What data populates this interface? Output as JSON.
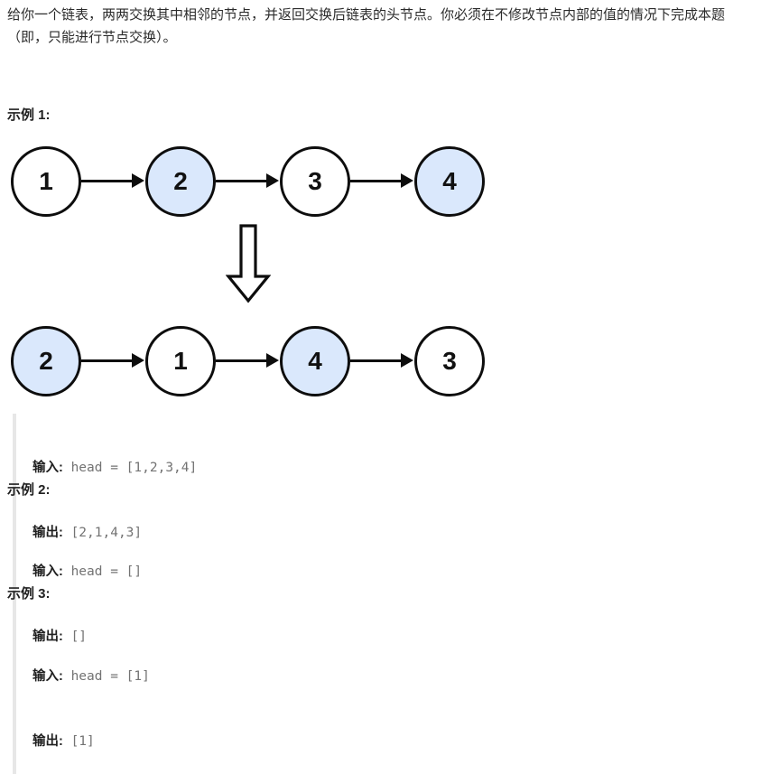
{
  "problem": {
    "description": "给你一个链表，两两交换其中相邻的节点，并返回交换后链表的头节点。你必须在不修改节点内部的值的情况下完成本题（即，只能进行节点交换）。"
  },
  "colors": {
    "highlight_node_fill": "#dae8fc",
    "node_stroke": "#0d0d0d",
    "node_fill": "#ffffff",
    "code_text": "#737373",
    "blockquote_border": "#e7e7e7",
    "body_text": "#2b2b2b"
  },
  "examples": [
    {
      "heading": "示例 1:",
      "input_label": "输入:",
      "input_value": " head = [1,2,3,4]",
      "output_label": "输出:",
      "output_value": " [2,1,4,3]"
    },
    {
      "heading": "示例 2:",
      "input_label": "输入:",
      "input_value": " head = []",
      "output_label": "输出:",
      "output_value": " []"
    },
    {
      "heading": "示例 3:",
      "input_label": "输入:",
      "input_value": " head = [1]",
      "output_label": "输出:",
      "output_value": " [1]"
    }
  ],
  "diagram": {
    "before_row": [
      {
        "value": "1",
        "highlighted": false
      },
      {
        "value": "2",
        "highlighted": true
      },
      {
        "value": "3",
        "highlighted": false
      },
      {
        "value": "4",
        "highlighted": true
      }
    ],
    "after_row": [
      {
        "value": "2",
        "highlighted": true
      },
      {
        "value": "1",
        "highlighted": false
      },
      {
        "value": "4",
        "highlighted": true
      },
      {
        "value": "3",
        "highlighted": false
      }
    ],
    "transform_arrow": "down-arrow"
  }
}
